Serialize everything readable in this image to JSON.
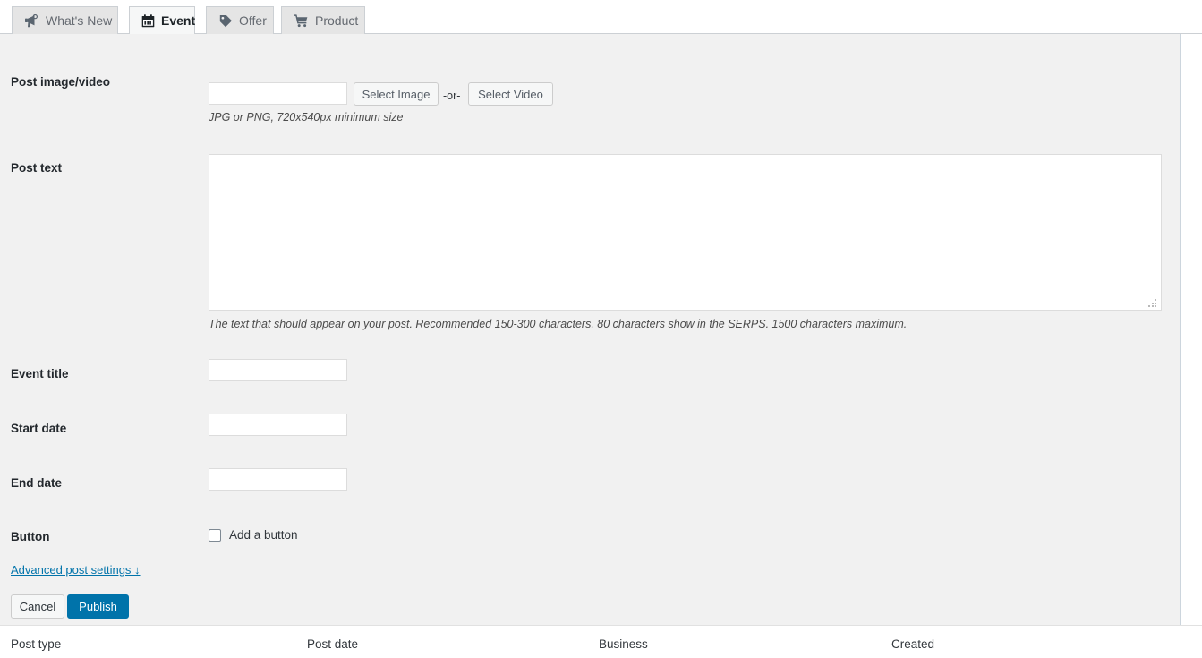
{
  "tabs": [
    {
      "label": "What's New",
      "icon": "megaphone-icon",
      "active": false
    },
    {
      "label": "Event",
      "icon": "calendar-icon",
      "active": true
    },
    {
      "label": "Offer",
      "icon": "tag-icon",
      "active": false
    },
    {
      "label": "Product",
      "icon": "shopping-cart-icon",
      "active": false
    }
  ],
  "form": {
    "image_row": {
      "label": "Post image/video",
      "input_value": "",
      "select_image_label": "Select Image",
      "or_label": "-or-",
      "select_video_label": "Select Video",
      "help": "JPG or PNG, 720x540px minimum size"
    },
    "post_text_row": {
      "label": "Post text",
      "value": "",
      "help": "The text that should appear on your post. Recommended 150-300 characters. 80 characters show in the SERPS. 1500 characters maximum."
    },
    "event_title_row": {
      "label": "Event title",
      "value": ""
    },
    "start_date_row": {
      "label": "Start date",
      "value": ""
    },
    "end_date_row": {
      "label": "End date",
      "value": ""
    },
    "button_row": {
      "label": "Button",
      "checkbox_label": "Add a button",
      "checked": false
    },
    "advanced_link": "Advanced post settings ↓",
    "cancel_label": "Cancel",
    "publish_label": "Publish"
  },
  "table": {
    "columns": [
      "Post type",
      "Post date",
      "Business",
      "Created"
    ]
  },
  "colors": {
    "accent": "#0073aa",
    "panel_bg": "#f1f1f1",
    "tab_inactive_bg": "#e5e5e5",
    "tab_active_bg": "#f6f7f7"
  }
}
